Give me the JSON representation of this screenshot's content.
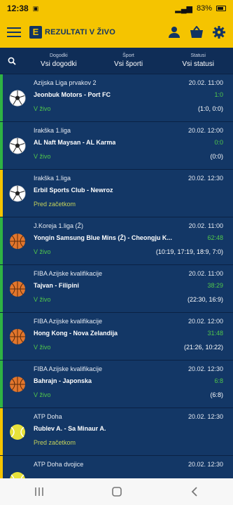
{
  "status_bar": {
    "time": "12:38",
    "battery": "83%"
  },
  "app": {
    "logo_letter": "E",
    "logo_text": "REZULTATI V ŽIVO"
  },
  "filters": [
    {
      "caption": "Dogodki",
      "value": "Vsi dogodki"
    },
    {
      "caption": "Šport",
      "value": "Vsi športi"
    },
    {
      "caption": "Statusi",
      "value": "Vsi statusi"
    }
  ],
  "colors": {
    "accent": "#f5c400",
    "background": "#123463",
    "live": "#51c84b",
    "pre_match": "#c4d25a",
    "stripe_live": "#2fb344",
    "stripe_pre": "#f5c400"
  },
  "matches": [
    {
      "sport": "football",
      "state": "live",
      "competition": "Azijska Liga prvakov 2",
      "date": "20.02. 11:00",
      "teams": "Jeonbuk Motors - Port FC",
      "score": "1:0",
      "status": "V živo",
      "detail": "(1:0, 0:0)"
    },
    {
      "sport": "football",
      "state": "live",
      "competition": "Irakška 1.liga",
      "date": "20.02. 12:00",
      "teams": "AL Naft Maysan - AL Karma",
      "score": "0:0",
      "status": "V živo",
      "detail": "(0:0)"
    },
    {
      "sport": "football",
      "state": "pre",
      "competition": "Irakška 1.liga",
      "date": "20.02. 12:30",
      "teams": "Erbil Sports Club - Newroz",
      "score": "",
      "status": "Pred začetkom",
      "detail": ""
    },
    {
      "sport": "basketball",
      "state": "live",
      "competition": "J.Koreja 1.liga (Ž)",
      "date": "20.02. 11:00",
      "teams": "Yongin Samsung Blue Mins (Ž) - Cheongju K...",
      "score": "62:48",
      "status": "V živo",
      "detail": "(10:19, 17:19, 18:9, 7:0)"
    },
    {
      "sport": "basketball",
      "state": "live",
      "competition": "FIBA Azijske kvalifikacije",
      "date": "20.02. 11:00",
      "teams": "Tajvan - Filipini",
      "score": "38:29",
      "status": "V živo",
      "detail": "(22:30, 16:9)"
    },
    {
      "sport": "basketball",
      "state": "live",
      "competition": "FIBA Azijske kvalifikacije",
      "date": "20.02. 12:00",
      "teams": "Hong Kong - Nova Zelandija",
      "score": "31:48",
      "status": "V živo",
      "detail": "(21:26, 10:22)"
    },
    {
      "sport": "basketball",
      "state": "live",
      "competition": "FIBA Azijske kvalifikacije",
      "date": "20.02. 12:30",
      "teams": "Bahrajn - Japonska",
      "score": "6:8",
      "status": "V živo",
      "detail": "(6:8)"
    },
    {
      "sport": "tennis",
      "state": "pre",
      "competition": "ATP Doha",
      "date": "20.02. 12:30",
      "teams": "Rublev A. - Sa Minaur A.",
      "score": "",
      "status": "Pred začetkom",
      "detail": ""
    },
    {
      "sport": "tennis",
      "state": "pre",
      "competition": "ATP Doha dvojice",
      "date": "20.02. 12:30",
      "teams": "",
      "score": "",
      "status": "",
      "detail": ""
    }
  ]
}
